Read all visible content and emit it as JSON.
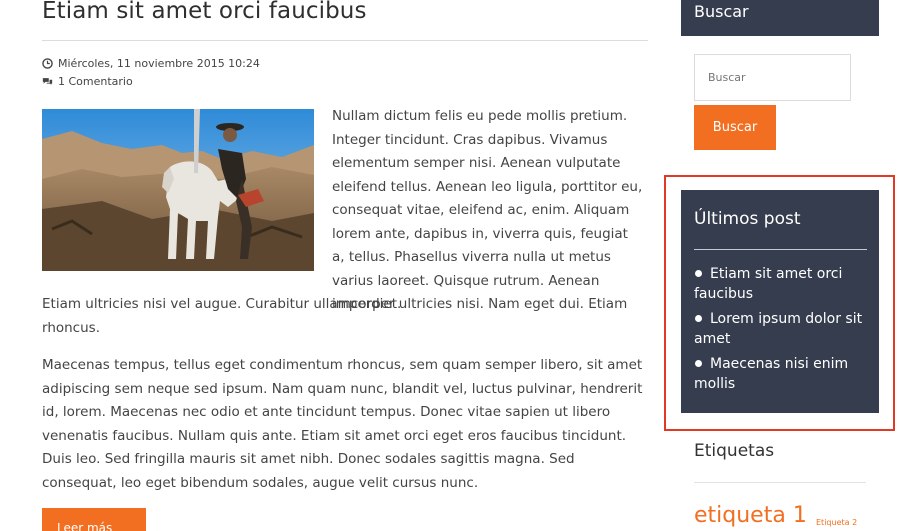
{
  "post": {
    "title": "Etiam sit amet orci faucibus",
    "date": "Miércoles, 11 noviembre 2015 10:24",
    "comments": "1 Comentario",
    "paragraph1_wrap": "Nullam dictum felis eu pede mollis pretium. Integer tincidunt. Cras dapibus. Vivamus elementum semper nisi. Aenean vulputate eleifend tellus. Aenean leo ligula, porttitor eu, consequat vitae, eleifend ac, enim. Aliquam lorem ante, dapibus in, viverra quis, feugiat a, tellus. Phasellus viverra nulla ut metus varius laoreet. Quisque rutrum. Aenean imperdiet.",
    "paragraph1_tail": "Etiam ultricies nisi vel augue. Curabitur ullamcorper ultricies nisi. Nam eget dui. Etiam rhoncus.",
    "paragraph2": "Maecenas tempus, tellus eget condimentum rhoncus, sem quam semper libero, sit amet adipiscing sem neque sed ipsum. Nam quam nunc, blandit vel, luctus pulvinar, hendrerit id, lorem. Maecenas nec odio et ante tincidunt tempus. Donec vitae sapien ut libero venenatis faucibus. Nullam quis ante. Etiam sit amet orci eget eros faucibus tincidunt. Duis leo. Sed fringilla mauris sit amet nibh. Donec sodales sagittis magna. Sed consequat, leo eget bibendum sodales, augue velit cursus nunc.",
    "read_more": "Leer más",
    "image_icon": "knight-on-horse-photo"
  },
  "sidebar": {
    "search": {
      "title": "Buscar",
      "placeholder": "Buscar",
      "button": "Buscar"
    },
    "recent": {
      "title": "Últimos post",
      "items": [
        "Etiam sit amet orci faucibus",
        "Lorem ipsum dolor sit amet",
        "Maecenas nisi enim mollis"
      ]
    },
    "tags": {
      "title": "Etiquetas",
      "items": [
        "etiqueta 1",
        "Etiqueta 2"
      ]
    }
  },
  "colors": {
    "accent": "#f26f21",
    "panel": "#353d4e",
    "highlight": "#e03a26"
  },
  "icons": {
    "date": "clock-icon",
    "comments": "comments-icon"
  }
}
